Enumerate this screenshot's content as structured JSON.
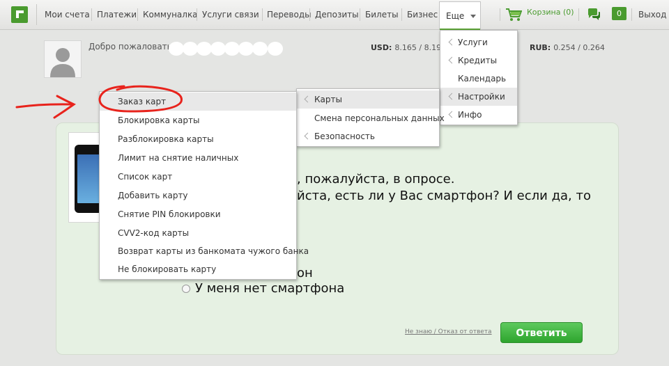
{
  "nav": {
    "items": [
      "Мои счета",
      "Платежи",
      "Коммуналка",
      "Услуги связи",
      "Переводы",
      "Депозиты",
      "Билеты",
      "Бизнес"
    ],
    "more_label": "Еще",
    "cart_label": "Корзина (0)",
    "messages_count": "0",
    "logout": "Выход"
  },
  "header": {
    "welcome": "Добро пожаловать,",
    "usd_label": "USD:",
    "usd_value": "8.165 / 8.195",
    "rub_label": "RUB:",
    "rub_value": "0.254 / 0.264"
  },
  "more_menu": {
    "items": [
      "Услуги",
      "Кредиты",
      "Календарь",
      "Настройки",
      "Инфо"
    ],
    "highlighted": "Настройки"
  },
  "settings_menu": {
    "items": [
      "Карты",
      "Смена персональных данных",
      "Безопасность"
    ],
    "highlighted": "Карты"
  },
  "cards_menu": {
    "items": [
      "Заказ карт",
      "Блокировка карты",
      "Разблокировка карты",
      "Лимит на снятие наличных",
      "Список карт",
      "Добавить карту",
      "Снятие PIN блокировки",
      "CVV2-код карты",
      "Возврат карты из банкомата чужого банка",
      "Не блокировать карту"
    ],
    "highlighted": "Заказ карт"
  },
  "survey": {
    "line1": ", пожалуйста, в опросе.",
    "line2": "йста, есть ли у Вас смартфон? И если да, то",
    "option_partial": "он",
    "option_no": "У меня нет смартфона",
    "skip": "Не знаю / Отказ от ответа",
    "answer_button": "Ответить"
  },
  "colors": {
    "brand_green": "#4a9b2f",
    "annotation_red": "#e8231c",
    "survey_bg": "#e6f1e3"
  },
  "icons": [
    "logo-icon",
    "cart-icon",
    "chat-icon",
    "chevron-left-icon",
    "chevron-down-icon",
    "avatar-icon",
    "smartphone-image",
    "red-arrow-annotation",
    "red-circle-annotation"
  ]
}
